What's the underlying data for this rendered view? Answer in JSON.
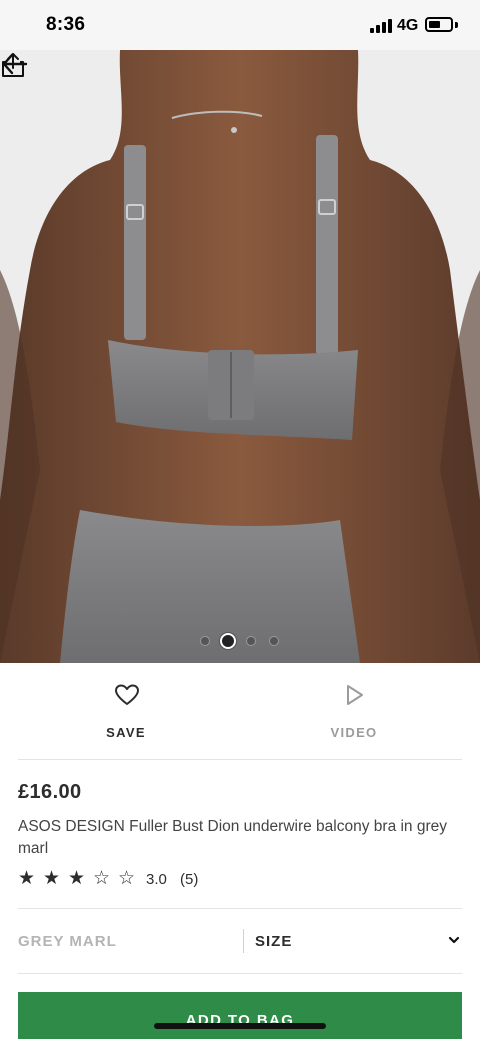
{
  "status_bar": {
    "time": "8:36",
    "network": "4G"
  },
  "product": {
    "image_alt": "Back view of model wearing grey marl balcony bra and bikini brief",
    "carousel": {
      "count": 4,
      "active_index": 1
    }
  },
  "actions": {
    "save_label": "SAVE",
    "video_label": "VIDEO"
  },
  "price": "£16.00",
  "title": "ASOS DESIGN Fuller Bust Dion underwire balcony bra in grey marl",
  "rating": {
    "value_text": "3.0",
    "count_text": "(5)",
    "stars_filled": 3,
    "stars_total": 5
  },
  "selectors": {
    "colour": "GREY MARL",
    "size": "SIZE"
  },
  "cta": {
    "add_to_bag": "ADD TO BAG"
  },
  "colors": {
    "accent_green": "#2f8b48",
    "text": "#2d2d2d",
    "muted": "#b4b4b4"
  },
  "icons": {
    "back": "arrow-left-icon",
    "share": "share-icon",
    "save": "heart-icon",
    "video": "play-icon",
    "dropdown": "chevron-down-icon",
    "star": "star-icon"
  }
}
